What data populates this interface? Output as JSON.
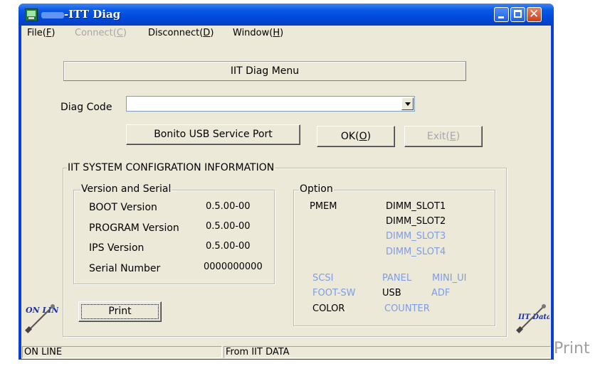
{
  "window": {
    "title": "-ITT Diag",
    "icon": "app-monitor-icon",
    "controls": [
      "minimize-icon",
      "maximize-icon",
      "close-icon"
    ],
    "accent": "#0a58e6"
  },
  "menubar": [
    {
      "label": "File(",
      "hotkey": "F",
      "suffix": ")",
      "enabled": true
    },
    {
      "label": "Connect(",
      "hotkey": "C",
      "suffix": ")",
      "enabled": false
    },
    {
      "label": "Disconnect(",
      "hotkey": "D",
      "suffix": ")",
      "enabled": true
    },
    {
      "label": "Window(",
      "hotkey": "H",
      "suffix": ")",
      "enabled": true
    }
  ],
  "header": {
    "title": "IIT Diag Menu"
  },
  "diag_code": {
    "label": "Diag Code",
    "value": ""
  },
  "buttons": {
    "bonito": "Bonito USB Service Port",
    "ok": {
      "label": "OK(",
      "hotkey": "O",
      "suffix": ")"
    },
    "exit": {
      "label": "Exit(",
      "hotkey": "E",
      "suffix": ")"
    },
    "print": "Print"
  },
  "config": {
    "title": "IIT SYSTEM CONFIGRATION INFORMATION",
    "version_group": {
      "title": "Version and Serial",
      "rows": [
        {
          "label": "BOOT Version",
          "value": "0.5.00-00"
        },
        {
          "label": "PROGRAM Version",
          "value": "0.5.00-00"
        },
        {
          "label": "IPS Version",
          "value": "0.5.00-00"
        },
        {
          "label": "Serial Number",
          "value": "0000000000"
        }
      ]
    },
    "option_group": {
      "title": "Option",
      "pmem": "PMEM",
      "slots": [
        {
          "label": "DIMM_SLOT1",
          "active": true
        },
        {
          "label": "DIMM_SLOT2",
          "active": true
        },
        {
          "label": "DIMM_SLOT3",
          "active": false
        },
        {
          "label": "DIMM_SLOT4",
          "active": false
        }
      ],
      "scsi": "SCSI",
      "panel": "PANEL",
      "mini_ui": "MINI_UI",
      "foot_sw": "FOOT-SW",
      "usb": "USB",
      "adf": "ADF",
      "color": "COLOR",
      "counter": "COUNTER"
    }
  },
  "icons": {
    "online": {
      "name": "online-plug-icon",
      "text": "ON LINE"
    },
    "iit_data": {
      "name": "iit-data-plug-icon",
      "text": "IIT Data"
    }
  },
  "statusbar": {
    "left": "ON LINE",
    "right": "From IIT DATA"
  },
  "outside_label": "Print",
  "colors": {
    "disabled_text": "#a7a6aa",
    "inactive_option": "#7f9de2",
    "face": "#ece9d8"
  }
}
